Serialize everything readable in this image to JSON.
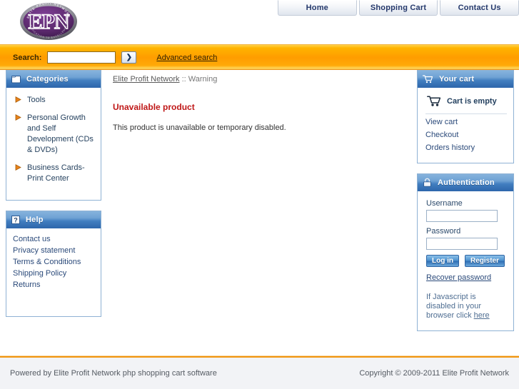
{
  "site": {
    "logo_text": "EPN",
    "logo_top_arc": "ELITE PROFIT NETWORK",
    "logo_bottom_arc": "DEDICATION TO EXCELLENCE"
  },
  "top_nav": {
    "items": [
      {
        "label": "Home"
      },
      {
        "label": "Shopping Cart"
      },
      {
        "label": "Contact Us"
      }
    ]
  },
  "search": {
    "label": "Search:",
    "value": "",
    "placeholder": "",
    "go_glyph": "❯",
    "advanced_label": "Advanced search"
  },
  "categories": {
    "title": "Categories",
    "items": [
      {
        "label": "Tools"
      },
      {
        "label": "Personal Growth and Self Development (CDs & DVDs)"
      },
      {
        "label": "Business Cards-Print Center"
      }
    ]
  },
  "help": {
    "title": "Help",
    "items": [
      {
        "label": "Contact us"
      },
      {
        "label": "Privacy statement"
      },
      {
        "label": "Terms & Conditions"
      },
      {
        "label": "Shipping Policy"
      },
      {
        "label": "Returns"
      }
    ]
  },
  "main": {
    "breadcrumb_root": "Elite Profit Network",
    "breadcrumb_sep": " :: ",
    "breadcrumb_current": "Warning",
    "warning_title": "Unavailable product",
    "warning_text": "This product is unavailable or temporary disabled."
  },
  "cart": {
    "title": "Your cart",
    "status": "Cart is empty",
    "links": [
      {
        "label": "View cart"
      },
      {
        "label": "Checkout"
      },
      {
        "label": "Orders history"
      }
    ]
  },
  "auth": {
    "title": "Authentication",
    "username_label": "Username",
    "username_value": "",
    "password_label": "Password",
    "password_value": "",
    "login_label": "Log in",
    "register_label": "Register",
    "recover_label": "Recover password",
    "js_note_text": "If Javascript is disabled in your browser click ",
    "js_note_link": "here"
  },
  "footer": {
    "left": "Powered by Elite Profit Network php shopping cart software",
    "right": "Copyright © 2009-2011 Elite Profit Network"
  },
  "colors": {
    "accent_orange": "#ff9d00",
    "panel_blue": "#417ec0",
    "warning_red": "#bf1717",
    "logo_purple": "#5c2a6e"
  }
}
